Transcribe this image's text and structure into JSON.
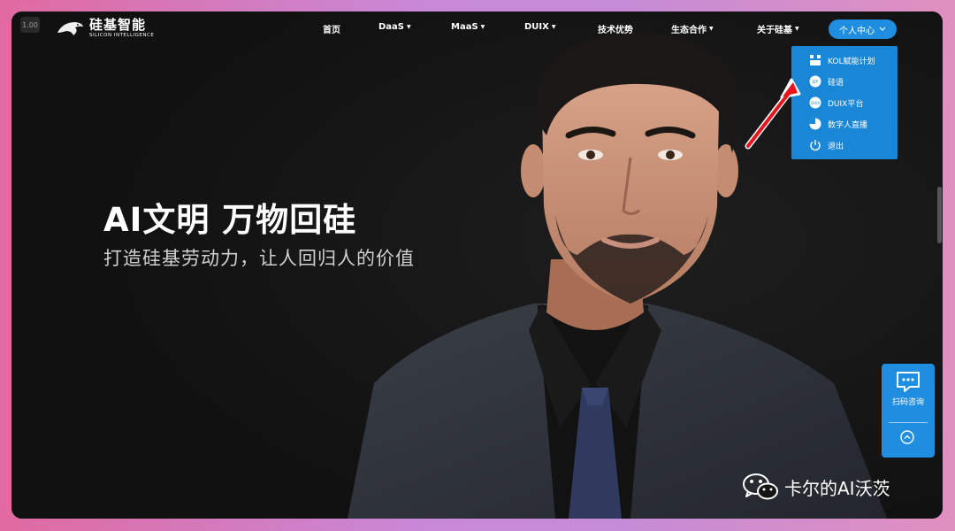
{
  "zoom_badge": "1.00",
  "logo": {
    "cn": "硅基智能",
    "en": "SILICON INTELLIGENCE"
  },
  "nav": {
    "items": [
      {
        "label": "首页",
        "caret": false
      },
      {
        "label": "DaaS",
        "caret": true
      },
      {
        "label": "MaaS",
        "caret": true
      },
      {
        "label": "DUIX",
        "caret": true
      },
      {
        "label": "技术优势",
        "caret": false
      },
      {
        "label": "生态合作",
        "caret": true
      },
      {
        "label": "关于硅基",
        "caret": true
      }
    ],
    "user_center": "个人中心"
  },
  "dropdown": {
    "items": [
      {
        "label": "KOL赋能计划",
        "icon": "kol-icon"
      },
      {
        "label": "硅语",
        "icon": "guiyu-icon"
      },
      {
        "label": "DUIX平台",
        "icon": "duix-icon"
      },
      {
        "label": "数字人直播",
        "icon": "live-icon"
      },
      {
        "label": "退出",
        "icon": "power-icon"
      }
    ]
  },
  "hero": {
    "headline": "AI文明 万物回硅",
    "subhead": "打造硅基劳动力，让人回归人的价值"
  },
  "float_panel": {
    "consult_label": "扫码咨询"
  },
  "watermark": "卡尔的AI沃茨",
  "colors": {
    "accent": "#1f8ee0",
    "dropdown_bg": "#1a86d6",
    "arrow": "#e8141c"
  }
}
